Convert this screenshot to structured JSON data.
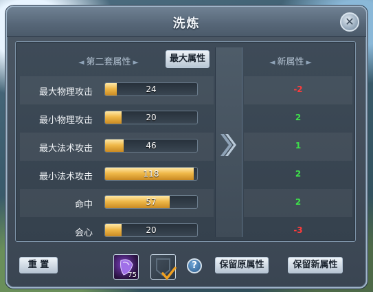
{
  "window": {
    "title": "洗炼"
  },
  "headers": {
    "left_title": "第二套属性",
    "max_attr_button": "最大属性",
    "right_title": "新属性"
  },
  "attributes": [
    {
      "label": "最大物理攻击",
      "value": "24",
      "fill_pct": 13,
      "delta": "-2",
      "delta_sign": "neg"
    },
    {
      "label": "最小物理攻击",
      "value": "20",
      "fill_pct": 18,
      "delta": "2",
      "delta_sign": "pos"
    },
    {
      "label": "最大法术攻击",
      "value": "46",
      "fill_pct": 20,
      "delta": "1",
      "delta_sign": "pos"
    },
    {
      "label": "最小法术攻击",
      "value": "118",
      "fill_pct": 96,
      "delta": "2",
      "delta_sign": "pos"
    },
    {
      "label": "命中",
      "value": "57",
      "fill_pct": 70,
      "delta": "2",
      "delta_sign": "pos"
    },
    {
      "label": "会心",
      "value": "20",
      "fill_pct": 18,
      "delta": "-3",
      "delta_sign": "neg"
    }
  ],
  "footer": {
    "reset_button": "重 置",
    "item_count": "75",
    "help_label": "?",
    "keep_original_button": "保留原属性",
    "keep_new_button": "保留新属性"
  },
  "colors": {
    "positive": "#3ee04a",
    "negative": "#ff3b3b",
    "bar_fill": "#f0b94a"
  }
}
